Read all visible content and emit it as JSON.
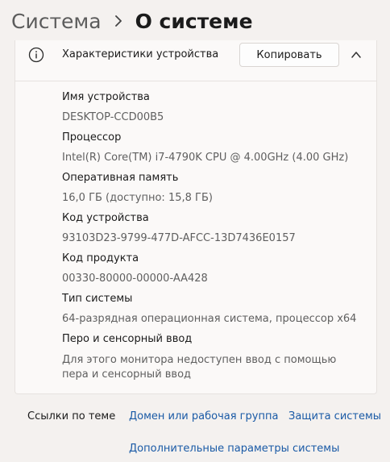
{
  "breadcrumb": {
    "parent": "Система",
    "current": "О системе"
  },
  "device_specs": {
    "header_title": "Характеристики устройства",
    "copy_label": "Копировать",
    "items": [
      {
        "label": "Имя устройства",
        "value": "DESKTOP-CCD00B5"
      },
      {
        "label": "Процессор",
        "value": "Intel(R) Core(TM) i7-4790K CPU @ 4.00GHz (4.00 GHz)"
      },
      {
        "label": "Оперативная память",
        "value": "16,0 ГБ (доступно: 15,8 ГБ)"
      },
      {
        "label": "Код устройства",
        "value": "93103D23-9799-477D-AFCC-13D7436E0157"
      },
      {
        "label": "Код продукта",
        "value": "00330-80000-00000-AA428"
      },
      {
        "label": "Тип системы",
        "value": "64-разрядная операционная система, процессор x64"
      },
      {
        "label": "Перо и сенсорный ввод",
        "value": "Для этого монитора недоступен ввод с помощью пера и сенсорный ввод"
      }
    ]
  },
  "related_links": {
    "label": "Ссылки по теме",
    "links": [
      "Домен или рабочая группа",
      "Защита системы",
      "Дополнительные параметры системы"
    ]
  },
  "colors": {
    "background": "#f4f1ef",
    "card": "#fbf9f8",
    "link": "#1a5aa6",
    "secondary_text": "#5f5f5f"
  },
  "icons": [
    "chevron-right-icon",
    "info-icon",
    "chevron-up-icon"
  ]
}
